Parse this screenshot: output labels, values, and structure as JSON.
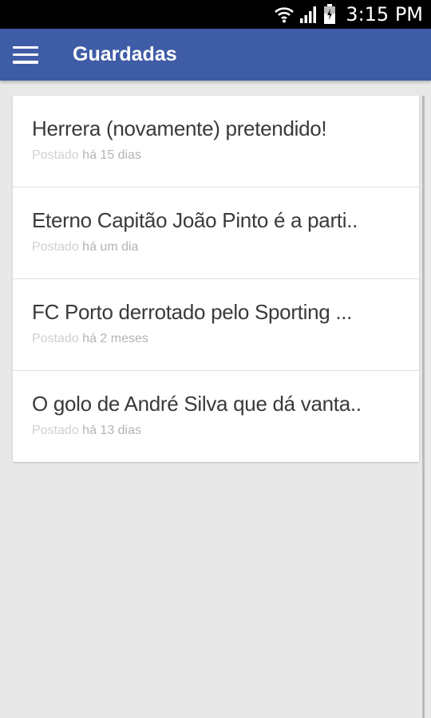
{
  "status_bar": {
    "time": "3:15 PM",
    "icons": [
      "wifi-icon",
      "signal-icon",
      "battery-icon"
    ]
  },
  "app_bar": {
    "menu_icon": "menu-icon",
    "title": "Guardadas",
    "color": "#3f5ca6"
  },
  "saved_items": [
    {
      "title": "Herrera (novamente) pretendido!",
      "posted_label": "Postado",
      "ago": "há 15 dias"
    },
    {
      "title": "Eterno Capitão João Pinto é a parti..",
      "posted_label": "Postado",
      "ago": "há um dia"
    },
    {
      "title": "FC Porto derrotado pelo Sporting ...",
      "posted_label": "Postado",
      "ago": "há 2 meses"
    },
    {
      "title": "O golo de André Silva que dá vanta..",
      "posted_label": "Postado",
      "ago": "há 13 dias"
    }
  ]
}
